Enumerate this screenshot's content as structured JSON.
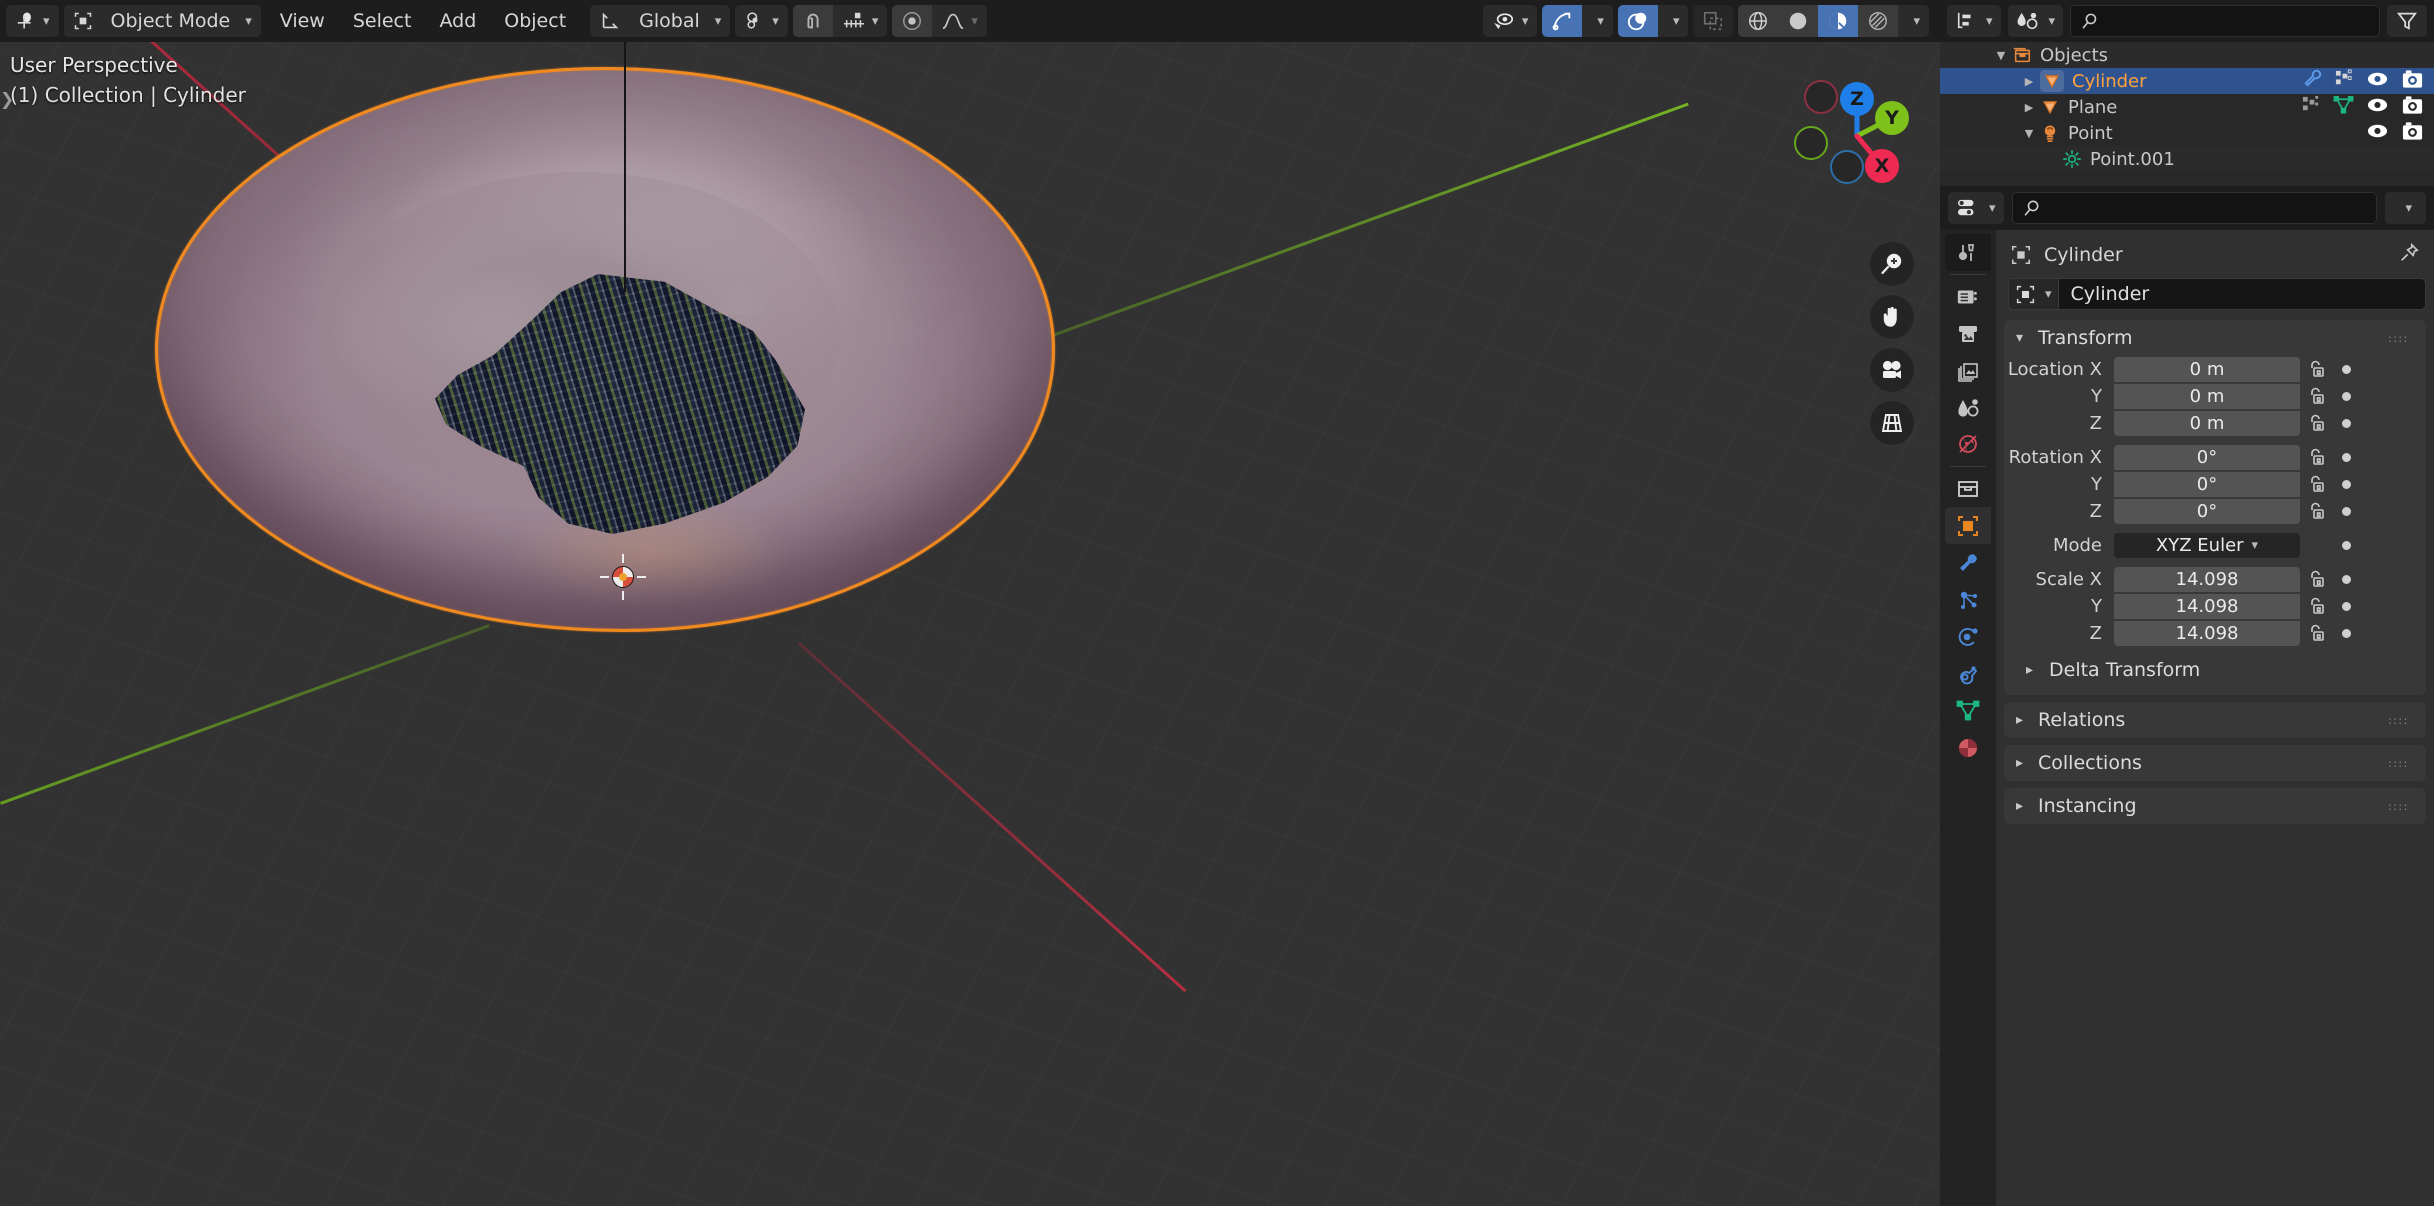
{
  "app": "Blender",
  "viewport_header": {
    "editor_type_icon": "editor-type-3dview-icon",
    "mode": "Object Mode",
    "mode_icon": "object-mode-icon",
    "menus": [
      "View",
      "Select",
      "Add",
      "Object"
    ],
    "transform_orientation": {
      "icon": "orientation-axes-icon",
      "value": "Global"
    },
    "pivot_icon": "pivot-point-icon",
    "snap_magnet_icon": "snap-magnet-icon",
    "snap_to_icon": "snap-increment-icon",
    "proportional_edit_icon": "proportional-edit-icon",
    "falloff_icon": "proportional-falloff-smooth-icon",
    "visibility_icon": "object-types-visibility-icon",
    "show_gizmo_icon": "show-gizmo-icon",
    "show_overlays_icon": "show-overlays-icon",
    "xray_icon": "toggle-xray-icon",
    "shading_modes": [
      "wireframe",
      "solid",
      "material-preview",
      "rendered"
    ],
    "shading_active": "material-preview",
    "shading_dropdown_icon": "chevron-down-icon"
  },
  "viewport_overlay": {
    "perspective": "User Perspective",
    "context": "(1) Collection | Cylinder"
  },
  "gizmo": {
    "axes": [
      {
        "label": "Z",
        "color": "#1f7fe8",
        "filled": true
      },
      {
        "label": "Y",
        "color": "#7ec11b",
        "filled": true
      },
      {
        "label": "X",
        "color": "#ef2a52",
        "filled": true
      },
      {
        "label": "",
        "color": "#8d3041",
        "filled": false
      },
      {
        "label": "",
        "color": "#4e7516",
        "filled": false
      },
      {
        "label": "",
        "color": "#2d5e96",
        "filled": false
      }
    ]
  },
  "viewport_tools": [
    {
      "name": "zoom-icon",
      "glyph": "zoom"
    },
    {
      "name": "move-hand-icon",
      "glyph": "hand"
    },
    {
      "name": "camera-view-icon",
      "glyph": "camera"
    },
    {
      "name": "toggle-ortho-persp-icon",
      "glyph": "grid"
    }
  ],
  "outliner": {
    "display_mode_icon": "outliner-display-mode-icon",
    "filter_id_icon": "filter-id-type-icon",
    "search_placeholder": "",
    "search_value": "",
    "filter_icon": "funnel-filter-icon",
    "rows": [
      {
        "label": "Objects",
        "icon": "collection-icon",
        "disclosure": "open",
        "indent": 1,
        "selected": false,
        "restrictions": []
      },
      {
        "label": "Cylinder",
        "icon": "mesh-object-icon",
        "disclosure": "closed",
        "indent": 2,
        "selected": true,
        "restrictions": [
          "modifier-wrench-icon",
          "mesh-data-icon",
          "eye-icon",
          "camera-icon"
        ]
      },
      {
        "label": "Plane",
        "icon": "mesh-object-icon",
        "disclosure": "closed",
        "indent": 2,
        "selected": false,
        "restrictions": [
          "mesh-data-icon",
          "mesh-triangle-icon",
          "eye-icon",
          "camera-icon"
        ]
      },
      {
        "label": "Point",
        "icon": "light-bulb-icon",
        "disclosure": "open",
        "indent": 2,
        "selected": false,
        "restrictions": [
          "eye-icon",
          "camera-icon"
        ]
      },
      {
        "label": "Point.001",
        "icon": "light-data-icon",
        "disclosure": "none",
        "indent": 3,
        "selected": false,
        "restrictions": []
      }
    ]
  },
  "properties": {
    "editor_icon": "properties-editor-icon",
    "search_placeholder": "",
    "search_value": "",
    "options_chevron": "chevron-down-icon",
    "tabs": [
      {
        "name": "tool-tab",
        "icon": "tool-screwdriver-wrench-icon",
        "active": false,
        "color": "#c8c8c8"
      },
      {
        "name": "render-tab",
        "icon": "render-camera-back-icon",
        "active": false,
        "color": "#c8c8c8"
      },
      {
        "name": "output-tab",
        "icon": "output-printer-icon",
        "active": false,
        "color": "#c8c8c8"
      },
      {
        "name": "view-layer-tab",
        "icon": "view-layer-images-icon",
        "active": false,
        "color": "#c8c8c8"
      },
      {
        "name": "scene-tab",
        "icon": "scene-cone-sphere-icon",
        "active": false,
        "color": "#c8c8c8"
      },
      {
        "name": "world-tab",
        "icon": "world-globe-icon",
        "active": false,
        "color": "#d14a5e"
      },
      {
        "name": "collection-tab",
        "icon": "collection-box-icon",
        "active": false,
        "color": "#c8c8c8"
      },
      {
        "name": "object-tab",
        "icon": "object-square-icon",
        "active": true,
        "color": "#e9861f"
      },
      {
        "name": "modifiers-tab",
        "icon": "modifier-wrench-icon",
        "active": false,
        "color": "#4b87d6"
      },
      {
        "name": "particles-tab",
        "icon": "particles-icon",
        "active": false,
        "color": "#4b87d6"
      },
      {
        "name": "physics-tab",
        "icon": "physics-orbit-icon",
        "active": false,
        "color": "#4b87d6"
      },
      {
        "name": "constraints-tab",
        "icon": "object-constraints-icon",
        "active": false,
        "color": "#4b87d6"
      },
      {
        "name": "data-tab",
        "icon": "mesh-data-triangle-icon",
        "active": false,
        "color": "#1eb584"
      },
      {
        "name": "material-tab",
        "icon": "material-sphere-icon",
        "active": false,
        "color": "#d15a64"
      }
    ],
    "breadcrumb": {
      "icon": "object-square-icon",
      "label": "Cylinder",
      "pin_icon": "pin-icon"
    },
    "id_block": {
      "type_icon": "object-square-icon",
      "name": "Cylinder"
    },
    "transform": {
      "title": "Transform",
      "expanded": true,
      "grip_icon": "panel-grip-icon",
      "fields": [
        {
          "label": "Location X",
          "value": "0 m",
          "lock": "unlocked-icon",
          "animate": "animate-dot-icon"
        },
        {
          "label": "Y",
          "value": "0 m",
          "lock": "unlocked-icon",
          "animate": "animate-dot-icon"
        },
        {
          "label": "Z",
          "value": "0 m",
          "lock": "unlocked-icon",
          "animate": "animate-dot-icon"
        },
        {
          "label": "Rotation X",
          "value": "0°",
          "lock": "unlocked-icon",
          "animate": "animate-dot-icon"
        },
        {
          "label": "Y",
          "value": "0°",
          "lock": "unlocked-icon",
          "animate": "animate-dot-icon"
        },
        {
          "label": "Z",
          "value": "0°",
          "lock": "unlocked-icon",
          "animate": "animate-dot-icon"
        }
      ],
      "mode": {
        "label": "Mode",
        "value": "XYZ Euler",
        "chevron": "chevron-down-icon",
        "animate": "animate-dot-icon"
      },
      "scale": [
        {
          "label": "Scale X",
          "value": "14.098",
          "lock": "unlocked-icon",
          "animate": "animate-dot-icon"
        },
        {
          "label": "Y",
          "value": "14.098",
          "lock": "unlocked-icon",
          "animate": "animate-dot-icon"
        },
        {
          "label": "Z",
          "value": "14.098",
          "lock": "unlocked-icon",
          "animate": "animate-dot-icon"
        }
      ],
      "delta_transform": {
        "label": "Delta Transform",
        "expanded": false
      }
    },
    "panels": [
      {
        "label": "Relations",
        "expanded": false
      },
      {
        "label": "Collections",
        "expanded": false
      },
      {
        "label": "Instancing",
        "expanded": false
      }
    ]
  },
  "colors": {
    "accent_selected": "#f08a1e",
    "outliner_selection": "#2f538f",
    "header_bg": "#1d1d1d",
    "panel_bg": "#383838",
    "props_bg": "#303030",
    "toggle_on": "#4772b3",
    "mesh_surface": "#9b8491",
    "rock_surface": "#2a3145"
  }
}
